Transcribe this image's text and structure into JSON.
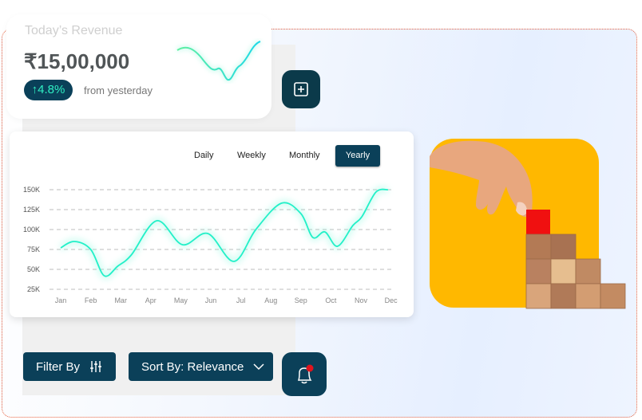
{
  "revenue_card": {
    "title": "Today’s Revenue",
    "amount": "₹15,00,000",
    "change": "↑4.8%",
    "change_label": "from yesterday"
  },
  "chart_tabs": [
    {
      "label": "Daily",
      "active": false
    },
    {
      "label": "Weekly",
      "active": false
    },
    {
      "label": "Monthly",
      "active": false
    },
    {
      "label": "Yearly",
      "active": true
    }
  ],
  "toolbar": {
    "filter_label": "Filter By",
    "sort_label": "Sort By: Relevance"
  },
  "colors": {
    "primary": "#0b4059",
    "accent": "#2ff0c4",
    "image_bg": "#ffb800",
    "notification_dot": "#e0141e"
  },
  "icons": {
    "add": "plus-square-icon",
    "filter": "sliders-icon",
    "sort": "chevron-down-icon",
    "notify": "bell-icon"
  },
  "chart_data": {
    "type": "line",
    "categories": [
      "Jan",
      "Feb",
      "Mar",
      "Apr",
      "May",
      "Jun",
      "Jul",
      "Aug",
      "Sep",
      "Oct",
      "Nov",
      "Dec"
    ],
    "y_ticks": [
      "150K",
      "125K",
      "100K",
      "75K",
      "50K",
      "25K"
    ],
    "y_tick_values": [
      150,
      125,
      100,
      75,
      50,
      25
    ],
    "ylim": [
      25,
      150
    ],
    "grid": true,
    "series": [
      {
        "points": [
          [
            0,
            77
          ],
          [
            0.45,
            85
          ],
          [
            1.0,
            75
          ],
          [
            1.45,
            42
          ],
          [
            1.9,
            54
          ],
          [
            2.35,
            68
          ],
          [
            3.2,
            111
          ],
          [
            4.05,
            81
          ],
          [
            4.9,
            95
          ],
          [
            5.77,
            60
          ],
          [
            6.5,
            100
          ],
          [
            7.35,
            133
          ],
          [
            8.0,
            120
          ],
          [
            8.4,
            90
          ],
          [
            8.8,
            97
          ],
          [
            9.22,
            79
          ],
          [
            9.73,
            105
          ],
          [
            10.03,
            116
          ],
          [
            10.5,
            147
          ],
          [
            10.9,
            150
          ]
        ]
      }
    ]
  }
}
